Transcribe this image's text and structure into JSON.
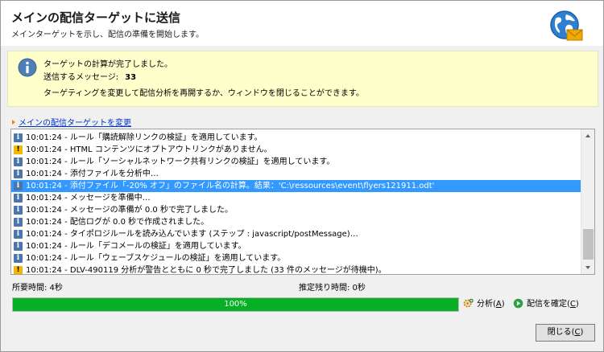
{
  "header": {
    "title": "メインの配信ターゲットに送信",
    "subtitle": "メインターゲットを示し、配信の準備を開始します。"
  },
  "info": {
    "line1": "ターゲットの計算が完了しました。",
    "messages_label": "送信するメッセージ:",
    "messages_count": "33",
    "line3": "ターゲティングを変更して配信分析を再開するか、ウィンドウを閉じることができます。"
  },
  "change_link": "メインの配信ターゲットを変更",
  "log": [
    {
      "icon": "info",
      "text": "10:01:24 - ルール「購読解除リンクの検証」を適用しています。"
    },
    {
      "icon": "warning",
      "text": "10:01:24 - HTML コンテンツにオプトアウトリンクがありません。"
    },
    {
      "icon": "info",
      "text": "10:01:24 - ルール「ソーシャルネットワーク共有リンクの検証」を適用しています。"
    },
    {
      "icon": "info",
      "text": "10:01:24 - 添付ファイルを分析中…"
    },
    {
      "icon": "info",
      "text": "10:01:24 - 添付ファイル「-20% オフ」のファイル名の計算。結果：'C:\\ressources\\event\\flyers121911.odt'",
      "selected": true
    },
    {
      "icon": "info",
      "text": "10:01:24 - メッセージを準備中…"
    },
    {
      "icon": "info",
      "text": "10:01:24 - メッセージの準備が 0.0 秒で完了しました。"
    },
    {
      "icon": "info",
      "text": "10:01:24 - 配信ログが 0.0 秒で作成されました。"
    },
    {
      "icon": "info",
      "text": "10:01:24 - タイポロジルールを読み込んでいます (ステップ : javascript/postMessage)…"
    },
    {
      "icon": "info",
      "text": "10:01:24 - ルール「デコメールの検証」を適用しています。"
    },
    {
      "icon": "info",
      "text": "10:01:24 - ルール「ウェーブスケジュールの検証」を適用しています。"
    },
    {
      "icon": "warning",
      "text": "10:01:24 - DLV-490119 分析が警告とともに 0 秒で完了しました (33 件のメッセージが待機中)。"
    }
  ],
  "status": {
    "elapsed": "所要時間: 4秒",
    "remaining": "推定残り時間: 0秒"
  },
  "progress": {
    "value": 1.0,
    "label": "100%"
  },
  "actions": {
    "analyze_label": "分析(",
    "analyze_key": "A",
    "confirm_label": "配信を確定(",
    "confirm_key": "C",
    "close_paren": ")"
  },
  "close_button": {
    "label": "閉じる(",
    "key": "C",
    "close_paren": ")"
  },
  "colors": {
    "progress_fill": "#06b025",
    "info_panel_bg": "#ffffcc",
    "selection": "#3399ff",
    "link": "#0033cc"
  }
}
